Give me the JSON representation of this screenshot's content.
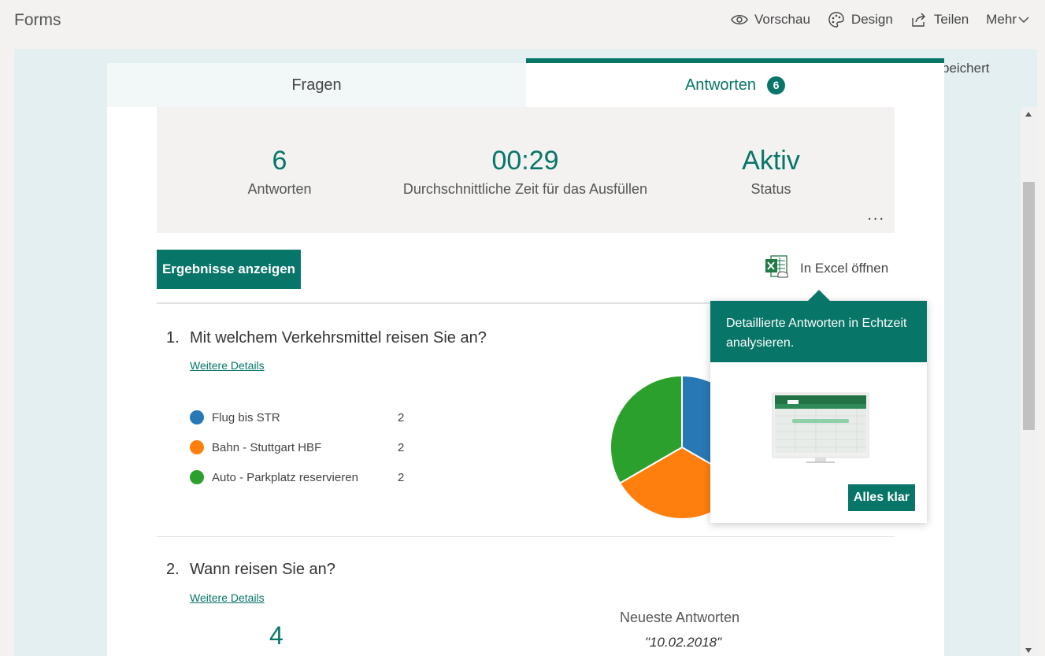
{
  "app": {
    "title": "Forms"
  },
  "toolbar": {
    "preview_label": "Vorschau",
    "design_label": "Design",
    "share_label": "Teilen",
    "more_label": "Mehr"
  },
  "saved_note": "peichert",
  "tabs": {
    "questions_label": "Fragen",
    "responses_label": "Antworten",
    "responses_count": "6"
  },
  "summary": {
    "responses_value": "6",
    "responses_label": "Antworten",
    "avg_time_value": "00:29",
    "avg_time_label": "Durchschnittliche Zeit für das Ausfüllen",
    "status_value": "Aktiv",
    "status_label": "Status",
    "more_label": "..."
  },
  "actions": {
    "view_results_label": "Ergebnisse anzeigen",
    "open_excel_label": "In Excel öffnen"
  },
  "question1": {
    "number": "1.",
    "text": "Mit welchem Verkehrsmittel reisen Sie an?",
    "details_label": "Weitere Details",
    "options": [
      {
        "label": "Flug bis STR",
        "count": "2",
        "color": "#2878b5"
      },
      {
        "label": "Bahn - Stuttgart HBF",
        "count": "2",
        "color": "#ff7f0e"
      },
      {
        "label": "Auto - Parkplatz reservieren",
        "count": "2",
        "color": "#2ca02c"
      }
    ]
  },
  "chart_data": {
    "type": "pie",
    "categories": [
      "Flug bis STR",
      "Bahn - Stuttgart HBF",
      "Auto - Parkplatz reservieren"
    ],
    "values": [
      2,
      2,
      2
    ],
    "colors": [
      "#2878b5",
      "#ff7f0e",
      "#2ca02c"
    ]
  },
  "tooltip": {
    "text": "Detaillierte Antworten in Echtzeit analysieren.",
    "button_label": "Alles klar"
  },
  "question2": {
    "number": "2.",
    "text": "Wann reisen Sie an?",
    "details_label": "Weitere Details",
    "count": "4",
    "recent_title": "Neueste Antworten",
    "recent_value": "\"10.02.2018\""
  }
}
